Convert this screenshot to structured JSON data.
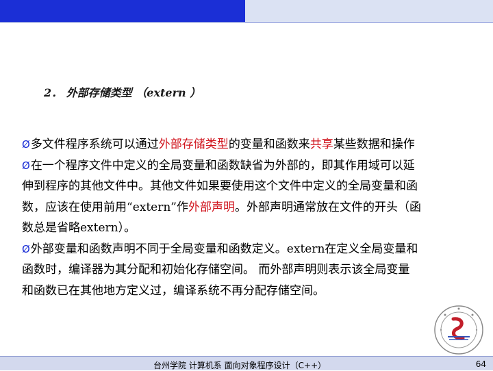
{
  "heading": {
    "number": "2．",
    "title": "外部存储类型 （extern ）"
  },
  "bullets": [
    {
      "marker": "Ø",
      "segments": [
        {
          "text": "多文件程序系统可以通过",
          "highlight": false
        },
        {
          "text": "外部存储类型",
          "highlight": true
        },
        {
          "text": "的变量和函数来",
          "highlight": false
        },
        {
          "text": "共享",
          "highlight": true
        },
        {
          "text": "某些数据和操作",
          "highlight": false
        }
      ]
    },
    {
      "marker": "Ø",
      "lines": [
        "在一个程序文件中定义的全局变量和函数缺省为外部的，即其作用域可以延",
        "伸到程序的其他文件中。其他文件如果要使用这个文件中定义的全局变量和函",
        "数，应该在使用前用“extern”作",
        "外部声明",
        "。外部声明通常放在文件的开头（函",
        "数总是省略extern）。"
      ]
    },
    {
      "marker": "Ø",
      "lines": [
        "外部变量和函数声明不同于全局变量和函数定义。extern在定义全局变量和",
        "函数时，编译器为其分配和初始化存储空间。 而外部声明则表示该全局变量",
        "和函数已在其他地方定义过，编译系统不再分配存储空间。"
      ]
    }
  ],
  "footer": {
    "text": "台州学院 计算机系 面向对象程序设计（C++）",
    "page": "64"
  },
  "colors": {
    "accent_blue": "#1b2fd6",
    "highlight_red": "#d0121b"
  },
  "logo": {
    "icon": "university-seal"
  }
}
